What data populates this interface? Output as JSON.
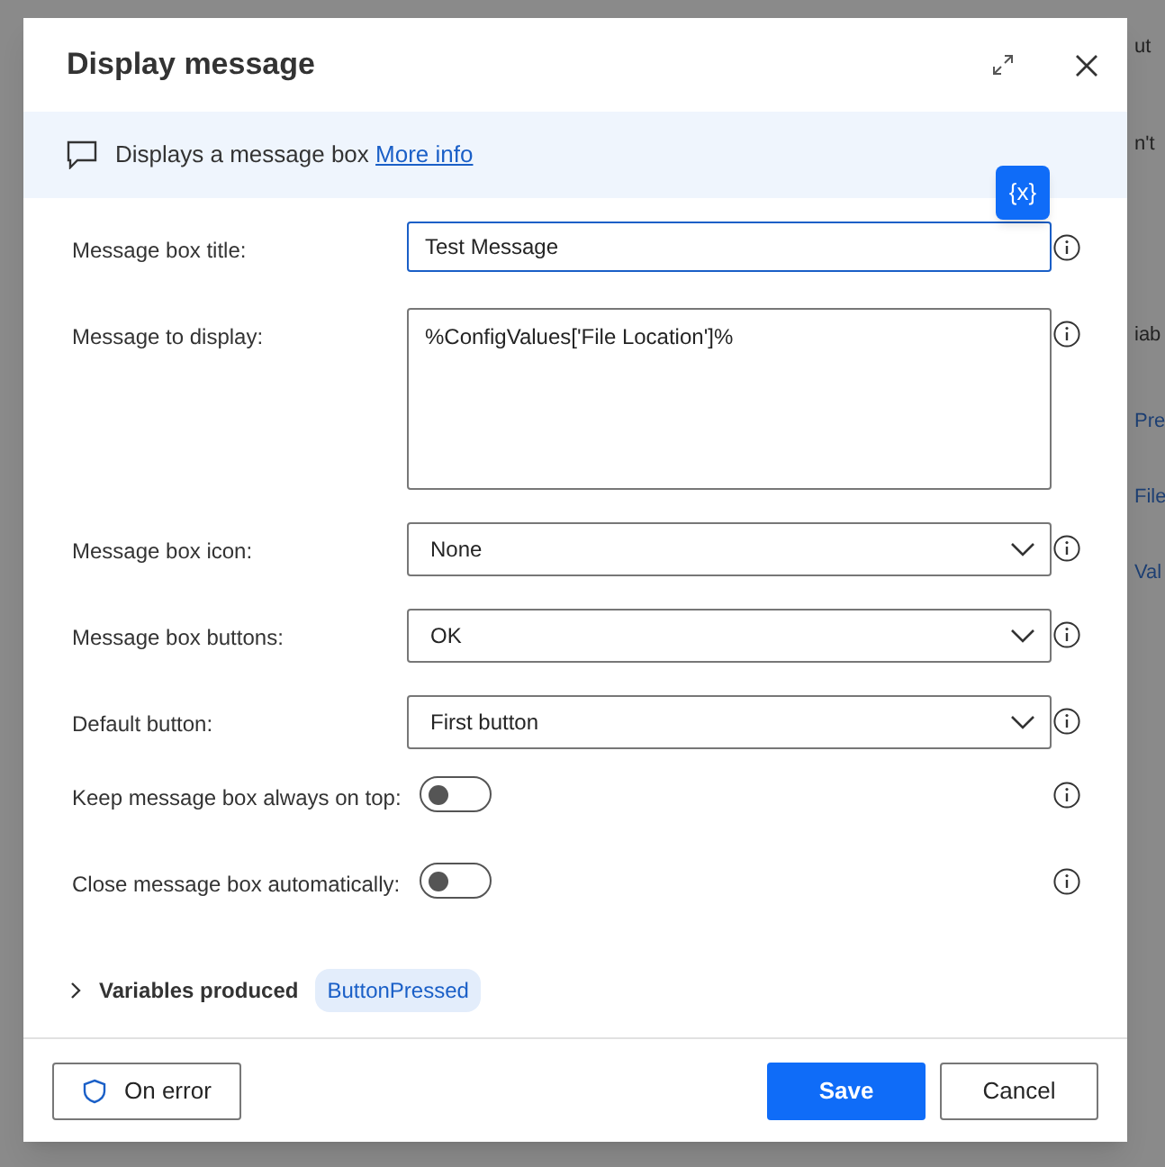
{
  "background_panel": {
    "fragments": [
      "ut",
      "n't",
      "iab",
      "Pre",
      "File",
      "Val"
    ]
  },
  "dialog": {
    "title": "Display message",
    "description": "Displays a message box",
    "more_info_link": "More info",
    "variables_button": "{x}",
    "fields": [
      {
        "kind": "text",
        "label": "Message box title:",
        "value": "Test Message",
        "focused": true
      },
      {
        "kind": "textarea",
        "label": "Message to display:",
        "value": "%ConfigValues['File Location']%",
        "focused": false
      },
      {
        "kind": "dropdown",
        "label": "Message box icon:",
        "value": "None",
        "focused": false
      },
      {
        "kind": "dropdown",
        "label": "Message box buttons:",
        "value": "OK",
        "focused": false
      },
      {
        "kind": "dropdown",
        "label": "Default button:",
        "value": "First button",
        "focused": false
      },
      {
        "kind": "toggle",
        "label": "Keep message box always on top:",
        "on": false
      },
      {
        "kind": "toggle",
        "label": "Close message box automatically:",
        "on": false
      }
    ],
    "variables_produced": {
      "label": "Variables produced",
      "expanded": false,
      "variables": [
        "ButtonPressed"
      ]
    },
    "buttons": {
      "on_error": "On error",
      "save": "Save",
      "cancel": "Cancel"
    }
  }
}
